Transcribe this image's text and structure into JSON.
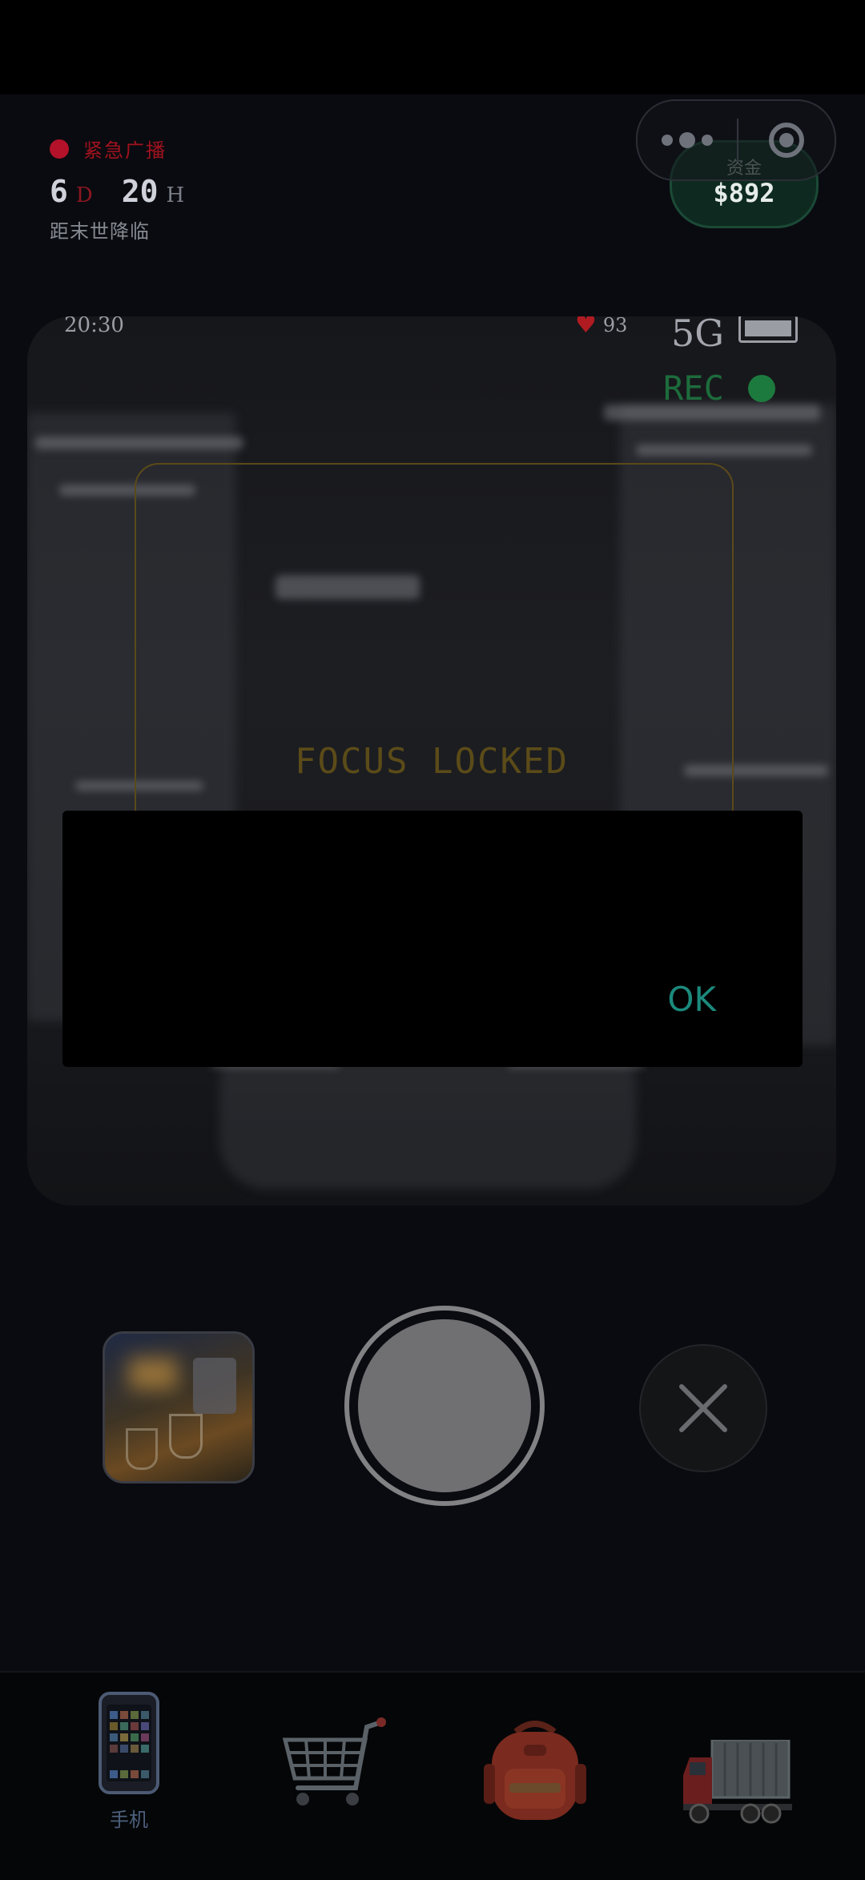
{
  "status": {
    "broadcast_label": "紧急广播",
    "countdown_days": "6",
    "countdown_day_unit": "D",
    "countdown_hours": "20",
    "countdown_hour_unit": "H",
    "countdown_caption": "距末世降临"
  },
  "funds": {
    "label": "资金",
    "value": "$892"
  },
  "viewfinder": {
    "time": "20:30",
    "health": "93",
    "network": "5G",
    "rec_label": "REC",
    "focus_text": "FOCUS LOCKED"
  },
  "dialog": {
    "ok_label": "OK"
  },
  "nav": {
    "items": [
      {
        "label": "手机",
        "icon": "phone-icon",
        "active": true
      },
      {
        "label": "",
        "icon": "shopping-cart-icon",
        "active": false
      },
      {
        "label": "",
        "icon": "backpack-icon",
        "active": false
      },
      {
        "label": "",
        "icon": "truck-icon",
        "active": false
      }
    ]
  },
  "colors": {
    "background": "#000000",
    "alert_red": "#b3122a",
    "rec_green": "#1d7a3e",
    "ok_teal": "#1b8a7c",
    "focus_amber": "#5b4b18"
  }
}
